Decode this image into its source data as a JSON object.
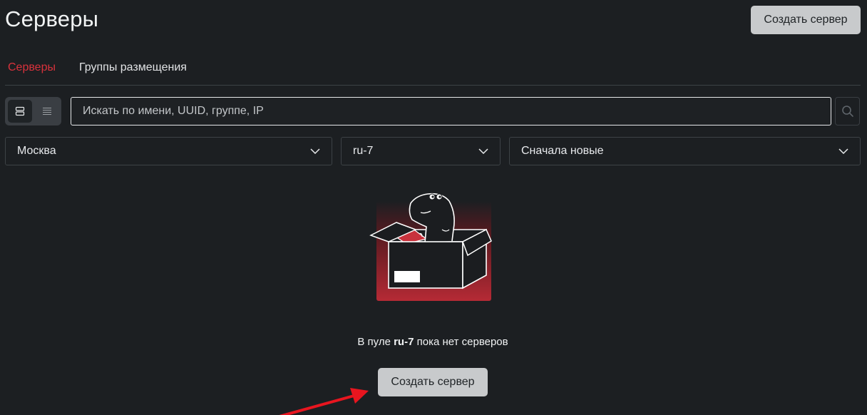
{
  "header": {
    "title": "Серверы",
    "create_button": "Создать сервер"
  },
  "tabs": [
    {
      "label": "Серверы",
      "active": true
    },
    {
      "label": "Группы размещения",
      "active": false
    }
  ],
  "view_toggle": {
    "options": [
      "cards-view-icon",
      "list-view-icon"
    ],
    "selected": "cards-view-icon"
  },
  "search": {
    "placeholder": "Искать по имени, UUID, группе, IP",
    "value": "",
    "icon": "search-icon"
  },
  "filters": {
    "city": "Москва",
    "pool": "ru-7",
    "sort": "Сначала новые"
  },
  "empty_state": {
    "prefix": "В пуле ",
    "pool": "ru-7",
    "suffix": " пока нет серверов",
    "create_button": "Создать сервер"
  },
  "colors": {
    "background": "#1c1f22",
    "accent": "#d9323c",
    "button_bg": "#c8cacc"
  }
}
